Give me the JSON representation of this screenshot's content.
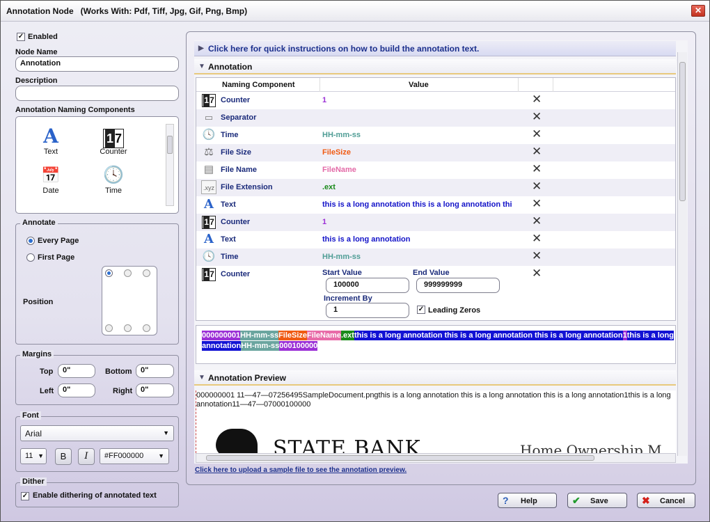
{
  "window": {
    "title": "Annotation Node",
    "subtitle": "(Works With: Pdf, Tiff, Jpg, Gif, Png, Bmp)",
    "close_glyph": "✕"
  },
  "left": {
    "enabled_label": "Enabled",
    "enabled_checked": true,
    "node_name_label": "Node Name",
    "node_name_value": "Annotation",
    "description_label": "Description",
    "description_value": "",
    "components_label": "Annotation Naming Components",
    "components": [
      {
        "label": "Text",
        "icon": "text-icon"
      },
      {
        "label": "Counter",
        "icon": "counter-icon"
      },
      {
        "label": "Date",
        "icon": "date-icon"
      },
      {
        "label": "Time",
        "icon": "time-icon"
      }
    ],
    "annotate": {
      "title": "Annotate",
      "every_page": "Every Page",
      "first_page": "First Page",
      "selected": "Every Page",
      "position_label": "Position"
    },
    "margins": {
      "title": "Margins",
      "top_label": "Top",
      "top_value": "0\"",
      "bottom_label": "Bottom",
      "bottom_value": "0\"",
      "left_label": "Left",
      "left_value": "0\"",
      "right_label": "Right",
      "right_value": "0\""
    },
    "font": {
      "title": "Font",
      "family": "Arial",
      "size": "11",
      "bold_label": "B",
      "italic_label": "I",
      "color": "#FF000000"
    },
    "dither": {
      "title": "Dither",
      "label": "Enable dithering of annotated text",
      "checked": true
    }
  },
  "right": {
    "quick_instructions": "Click here for quick instructions on how to build the annotation text.",
    "annotation_section": "Annotation",
    "columns": {
      "component": "Naming Component",
      "value": "Value"
    },
    "rows": [
      {
        "icon": "counter-icon",
        "name": "Counter",
        "value": "1",
        "color": "#9b2fd6"
      },
      {
        "icon": "separator-icon",
        "name": "Separator",
        "value": "",
        "color": "#111111"
      },
      {
        "icon": "time-icon",
        "name": "Time",
        "value": "HH-mm-ss",
        "color": "#4f9d95"
      },
      {
        "icon": "file-size-icon",
        "name": "File Size",
        "value": "FileSize",
        "color": "#f05a12"
      },
      {
        "icon": "file-name-icon",
        "name": "File Name",
        "value": "FileName",
        "color": "#e36aa7"
      },
      {
        "icon": "file-extension-icon",
        "name": "File Extension",
        "value": ".ext",
        "color": "#1a8a1a"
      },
      {
        "icon": "text-icon",
        "name": "Text",
        "value": "this is a long annotation this is a long annotation this",
        "color": "#1212c8"
      },
      {
        "icon": "counter-icon",
        "name": "Counter",
        "value": "1",
        "color": "#9b2fd6"
      },
      {
        "icon": "text-icon",
        "name": "Text",
        "value": "this is a long annotation",
        "color": "#1212c8"
      },
      {
        "icon": "time-icon",
        "name": "Time",
        "value": "HH-mm-ss",
        "color": "#4f9d95"
      }
    ],
    "counter_row": {
      "name": "Counter",
      "start_label": "Start Value",
      "start_value": "100000",
      "end_label": "End Value",
      "end_value": "999999999",
      "increment_label": "Increment By",
      "increment_value": "1",
      "leading_zeros_label": "Leading Zeros",
      "leading_zeros_checked": true
    },
    "delete_glyph": "✕",
    "chips": [
      {
        "text": "000000001",
        "bg": "#9b2fd6"
      },
      {
        "text": "HH-mm-ss",
        "bg": "#6aa59f"
      },
      {
        "text": "FileSize",
        "bg": "#f05a12"
      },
      {
        "text": "FileName",
        "bg": "#e86aa8"
      },
      {
        "text": ".ext",
        "bg": "#1a8a1a"
      },
      {
        "text": "this is a long annotation this is a long annotation this is a long annotation",
        "bg": "#1212d4"
      },
      {
        "text": "1",
        "bg": "#9b2fd6"
      },
      {
        "text": "this is a long annotation",
        "bg": "#1212d4"
      },
      {
        "text": "HH-mm-ss",
        "bg": "#6aa59f"
      },
      {
        "text": "000100000",
        "bg": "#9b2fd6"
      }
    ],
    "preview_section": "Annotation Preview",
    "preview_text": "000000001 11—47—07256495SampleDocument.pngthis is a long annotation this is a long annotation this is a long annotation1this is a long annotation11—47—07000100000",
    "preview_bank_name": "STATE BANK",
    "preview_bank_tagline": "Home Ownership M",
    "upload_link": "Click here to upload a sample file to see the annotation preview."
  },
  "buttons": {
    "help": "Help",
    "save": "Save",
    "cancel": "Cancel"
  }
}
